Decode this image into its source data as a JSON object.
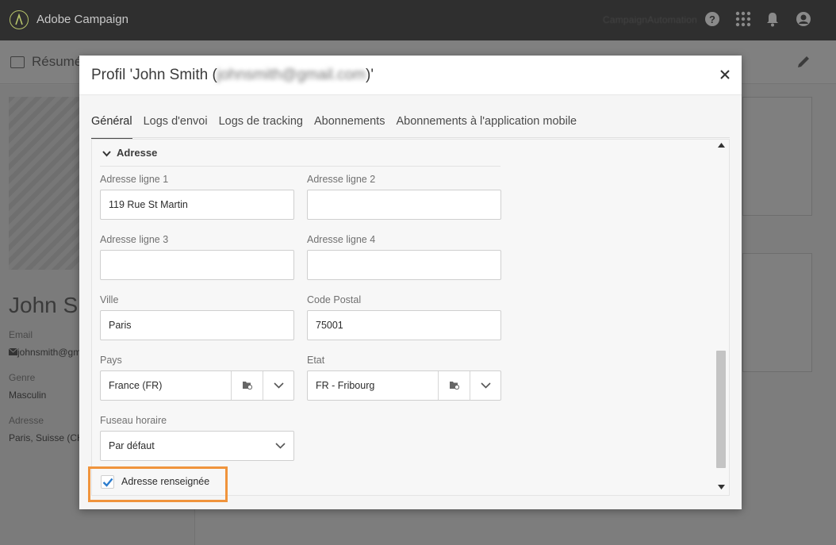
{
  "app": {
    "title": "Adobe Campaign",
    "org": "CampaignAutomation"
  },
  "topbar_icons": [
    "help-icon",
    "apps-grid-icon",
    "notifications-bell-icon",
    "user-avatar-icon"
  ],
  "background": {
    "title": "Résumé",
    "name": "John Sm",
    "fields": [
      {
        "label": "Email",
        "value": "johnsmith@gm"
      },
      {
        "label": "Genre",
        "value": "Masculin"
      },
      {
        "label": "Adresse",
        "value": "Paris, Suisse (CH)"
      }
    ]
  },
  "modal": {
    "title_prefix": "Profil 'John Smith (",
    "title_email": "johnsmith@gmail.com",
    "title_suffix": ")'",
    "tabs": [
      {
        "label": "Général",
        "active": true
      },
      {
        "label": "Logs d'envoi",
        "active": false
      },
      {
        "label": "Logs de tracking",
        "active": false
      },
      {
        "label": "Abonnements",
        "active": false
      },
      {
        "label": "Abonnements à l'application mobile",
        "active": false
      }
    ],
    "section": {
      "title": "Adresse",
      "address_line1": {
        "label": "Adresse ligne 1",
        "value": "119 Rue St Martin"
      },
      "address_line2": {
        "label": "Adresse ligne 2",
        "value": ""
      },
      "address_line3": {
        "label": "Adresse ligne 3",
        "value": ""
      },
      "address_line4": {
        "label": "Adresse ligne 4",
        "value": ""
      },
      "city": {
        "label": "Ville",
        "value": "Paris"
      },
      "zip": {
        "label": "Code Postal",
        "value": "75001"
      },
      "country": {
        "label": "Pays",
        "value": "France (FR)"
      },
      "state": {
        "label": "Etat",
        "value": "FR - Fribourg"
      },
      "timezone": {
        "label": "Fuseau horaire",
        "value": "Par défaut"
      },
      "address_filled": {
        "label": "Adresse renseignée",
        "checked": true
      }
    }
  },
  "colors": {
    "accent_checkbox": "#2c7ccd",
    "highlight": "#f0943c",
    "topbar": "#2f2f2f"
  }
}
